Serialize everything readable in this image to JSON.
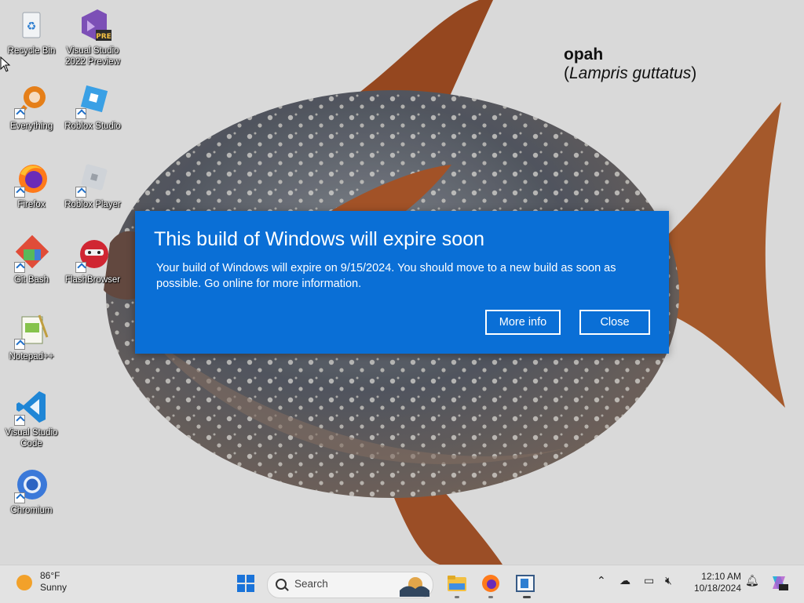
{
  "wallpaper": {
    "common_name": "opah",
    "scientific_name": "Lampris guttatus"
  },
  "desktop_icons": [
    {
      "label": "Recycle Bin",
      "icon": "recycle-bin-icon"
    },
    {
      "label": "Visual Studio 2022 Preview",
      "icon": "visual-studio-preview-icon",
      "badge": "PRE"
    },
    {
      "label": "Everything",
      "icon": "everything-search-icon"
    },
    {
      "label": "Roblox Studio",
      "icon": "roblox-studio-icon"
    },
    {
      "label": "Firefox",
      "icon": "firefox-icon"
    },
    {
      "label": "Roblox Player",
      "icon": "roblox-player-icon"
    },
    {
      "label": "Git Bash",
      "icon": "git-bash-icon"
    },
    {
      "label": "FlashBrowser",
      "icon": "flashbrowser-icon"
    },
    {
      "label": "Notepad++",
      "icon": "notepad-plus-plus-icon"
    },
    {
      "label": "Visual Studio Code",
      "icon": "vscode-icon"
    },
    {
      "label": "Chromium",
      "icon": "chromium-icon"
    }
  ],
  "dialog": {
    "title": "This build of Windows will expire soon",
    "message": "Your build of Windows will expire on 9/15/2024. You should move to a new build as soon as possible. Go online for more information.",
    "more_info_label": "More info",
    "close_label": "Close",
    "accent_color": "#0a6fd6"
  },
  "taskbar": {
    "weather": {
      "temp": "86°F",
      "condition": "Sunny"
    },
    "search_placeholder": "Search",
    "apps": [
      "start-icon",
      "search",
      "file-explorer-icon",
      "firefox-icon",
      "task-manager-icon"
    ],
    "clock": {
      "time": "12:10 AM",
      "date": "10/18/2024"
    }
  }
}
